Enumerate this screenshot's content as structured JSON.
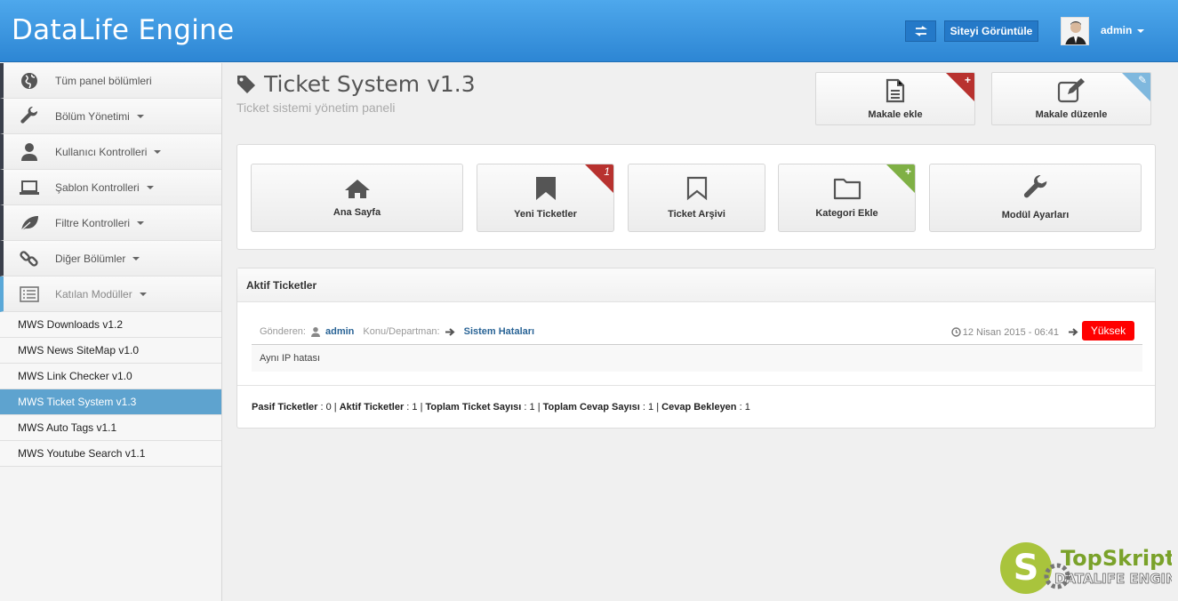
{
  "header": {
    "brand": "DataLife Engine",
    "swap_icon": "exchange-icon",
    "view_site": "Siteyi Görüntüle",
    "user": "admin"
  },
  "sidebar": {
    "items": [
      {
        "label": "Tüm panel bölümleri",
        "icon": "globe-icon",
        "dropdown": false
      },
      {
        "label": "Bölüm Yönetimi",
        "icon": "wrench-icon",
        "dropdown": true
      },
      {
        "label": "Kullanıcı Kontrolleri",
        "icon": "user-icon",
        "dropdown": true
      },
      {
        "label": "Şablon Kontrolleri",
        "icon": "laptop-icon",
        "dropdown": true
      },
      {
        "label": "Filtre Kontrolleri",
        "icon": "leaf-icon",
        "dropdown": true
      },
      {
        "label": "Diğer Bölümler",
        "icon": "link-icon",
        "dropdown": true
      },
      {
        "label": "Katılan Modüller",
        "icon": "list-icon",
        "dropdown": true
      }
    ],
    "sub_items": [
      "MWS Downloads v1.2",
      "MWS News SiteMap v1.0",
      "MWS Link Checker v1.0",
      "MWS Ticket System v1.3",
      "MWS Auto Tags v1.1",
      "MWS Youtube Search v1.1"
    ],
    "selected_sub": "MWS Ticket System v1.3"
  },
  "page": {
    "title": "Ticket System v1.3",
    "subtitle": "Ticket sistemi yönetim paneli",
    "quick": {
      "add_article": "Makale ekle",
      "edit_article": "Makale düzenle"
    }
  },
  "tiles": {
    "home": "Ana Sayfa",
    "new_tickets": "Yeni Ticketler",
    "new_tickets_badge": "1",
    "archive": "Ticket Arşivi",
    "add_category": "Kategori Ekle",
    "settings": "Modül Ayarları"
  },
  "tickets": {
    "title": "Aktif Ticketler",
    "row": {
      "sender_label": "Gönderen:",
      "sender": "admin",
      "topic_label": "Konu/Departman:",
      "topic": "Sistem Hataları",
      "date": "12 Nisan 2015 - 06:41",
      "priority": "Yüksek",
      "message": "Aynı IP hatası"
    },
    "stats": {
      "passive_label": "Pasif Ticketler",
      "passive": "0",
      "active_label": "Aktif Ticketler",
      "active": "1",
      "total_label": "Toplam Ticket Sayısı",
      "total": "1",
      "replies_label": "Toplam Cevap Sayısı",
      "replies": "1",
      "waiting_label": "Cevap Bekleyen",
      "waiting": "1"
    }
  },
  "logo": {
    "name": "TopSkript",
    "sub": "DATALIFE ENGINE"
  },
  "colors": {
    "header": "#3a95e0",
    "priority": "#ff0000",
    "selected_sub": "#5ea3cf",
    "badge_red": "#b8322f",
    "badge_green": "#7fb045"
  }
}
